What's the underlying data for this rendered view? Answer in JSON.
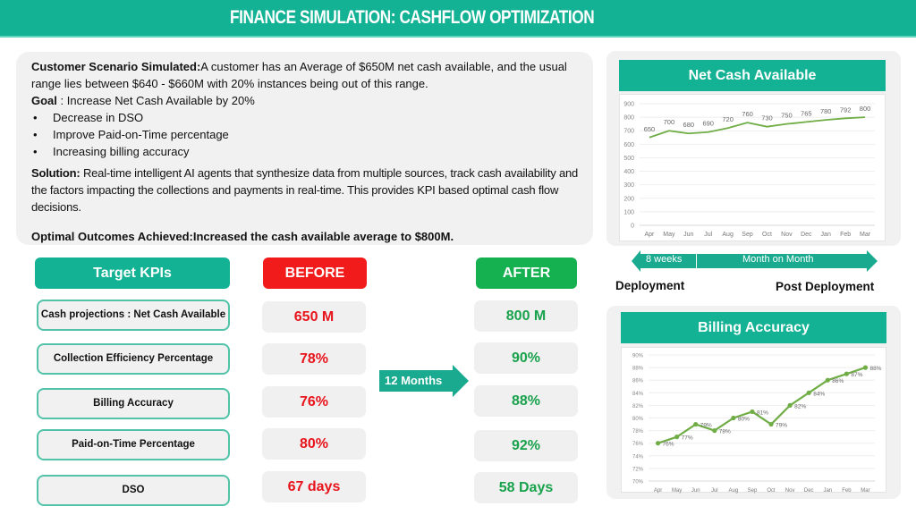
{
  "header": {
    "title": "FINANCE SIMULATION: CASHFLOW OPTIMIZATION"
  },
  "scenario": {
    "scenario_label": "Customer Scenario Simulated:",
    "scenario_text": "A customer has an Average of $650M net cash available, and the usual range lies between  $640 - $660M with 20% instances being out of this range.",
    "goal_label": "Goal",
    "goal_text": " : Increase Net Cash Available  by 20%",
    "bullets": [
      "Decrease in DSO",
      "Improve Paid-on-Time percentage",
      "Increasing billing accuracy"
    ],
    "bullet_glyph": "•",
    "solution_label": "Solution:",
    "solution_text": " Real-time intelligent AI agents that synthesize data from multiple sources, track cash availability and the factors impacting the collections and payments in real-time. This  provides KPI based optimal cash flow decisions.",
    "outcome_label": "Optimal Outcomes Achieved:",
    "outcome_text": "Increased the cash available average to $800M."
  },
  "kpi_table": {
    "headers": {
      "kpi": "Target KPIs",
      "before": "BEFORE",
      "after": "AFTER"
    },
    "rows": [
      {
        "label": "Cash projections : Net Cash Available",
        "before": "650 M",
        "after": "800 M"
      },
      {
        "label": "Collection Efficiency Percentage",
        "before": "78%",
        "after": "90%"
      },
      {
        "label": "Billing Accuracy",
        "before": "76%",
        "after": "88%"
      },
      {
        "label": "Paid-on-Time Percentage",
        "before": "80%",
        "after": "92%"
      },
      {
        "label": "DSO",
        "before": "67 days",
        "after": "58 Days"
      }
    ],
    "transition_label": "12 Months"
  },
  "timeline": {
    "left_segment": "8 weeks",
    "right_segment": "Month on Month",
    "deployment_label": "Deployment",
    "post_deployment_label": "Post Deployment"
  },
  "colors": {
    "brand_teal": "#13b294",
    "before_red": "#e8141c",
    "after_green": "#19a24c",
    "line_green": "#70ad47"
  },
  "chart_data": [
    {
      "type": "line",
      "title": "Net Cash Available",
      "categories": [
        "Apr",
        "May",
        "Jun",
        "Jul",
        "Aug",
        "Sep",
        "Oct",
        "Nov",
        "Dec",
        "Jan",
        "Feb",
        "Mar"
      ],
      "series": [
        {
          "name": "Net Cash Available",
          "values": [
            650,
            700,
            680,
            690,
            720,
            760,
            730,
            750,
            765,
            780,
            792,
            800
          ]
        }
      ],
      "ylim": [
        0,
        900
      ],
      "yticks": [
        0,
        100,
        200,
        300,
        400,
        500,
        600,
        700,
        800,
        900
      ],
      "ytick_labels": [
        "0",
        "100",
        "200",
        "300",
        "400",
        "500",
        "600",
        "700",
        "800",
        "900"
      ],
      "data_labels": [
        "650",
        "700",
        "680",
        "690",
        "720",
        "760",
        "730",
        "750",
        "765",
        "780",
        "792",
        "800"
      ],
      "markers": false,
      "grid": true,
      "xlabel": "",
      "ylabel": ""
    },
    {
      "type": "line",
      "title": "Billing Accuracy",
      "categories": [
        "Apr",
        "May",
        "Jun",
        "Jul",
        "Aug",
        "Sep",
        "Oct",
        "Nov",
        "Dec",
        "Jan",
        "Feb",
        "Mar"
      ],
      "series": [
        {
          "name": "Billing Accuracy",
          "values": [
            76,
            77,
            79,
            78,
            80,
            81,
            79,
            82,
            84,
            86,
            87,
            88
          ]
        }
      ],
      "ylim": [
        70,
        90
      ],
      "yticks": [
        70,
        72,
        74,
        76,
        78,
        80,
        82,
        84,
        86,
        88,
        90
      ],
      "ytick_labels": [
        "70%",
        "72%",
        "74%",
        "76%",
        "78%",
        "80%",
        "82%",
        "84%",
        "86%",
        "88%",
        "90%"
      ],
      "data_labels": [
        "76%",
        "77%",
        "79%",
        "78%",
        "80%",
        "81%",
        "79%",
        "82%",
        "84%",
        "86%",
        "87%",
        "88%"
      ],
      "markers": true,
      "grid": true,
      "xlabel": "",
      "ylabel": ""
    }
  ]
}
